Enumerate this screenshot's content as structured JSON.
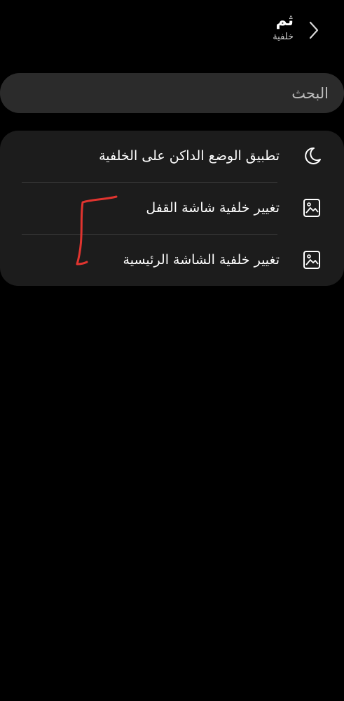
{
  "header": {
    "title": "ثم",
    "subtitle": "خلفية"
  },
  "search": {
    "placeholder": "البحث"
  },
  "menu": {
    "items": [
      {
        "label": "تطبيق الوضع الداكن على الخلفية",
        "icon": "moon-icon"
      },
      {
        "label": "تغيير خلفية شاشة القفل",
        "icon": "image-icon"
      },
      {
        "label": "تغيير خلفية الشاشة الرئيسية",
        "icon": "image-icon"
      }
    ]
  },
  "colors": {
    "background": "#000000",
    "search_bg": "#2b2b2b",
    "card_bg": "#1c1c1c",
    "annotation": "#e0342f"
  }
}
